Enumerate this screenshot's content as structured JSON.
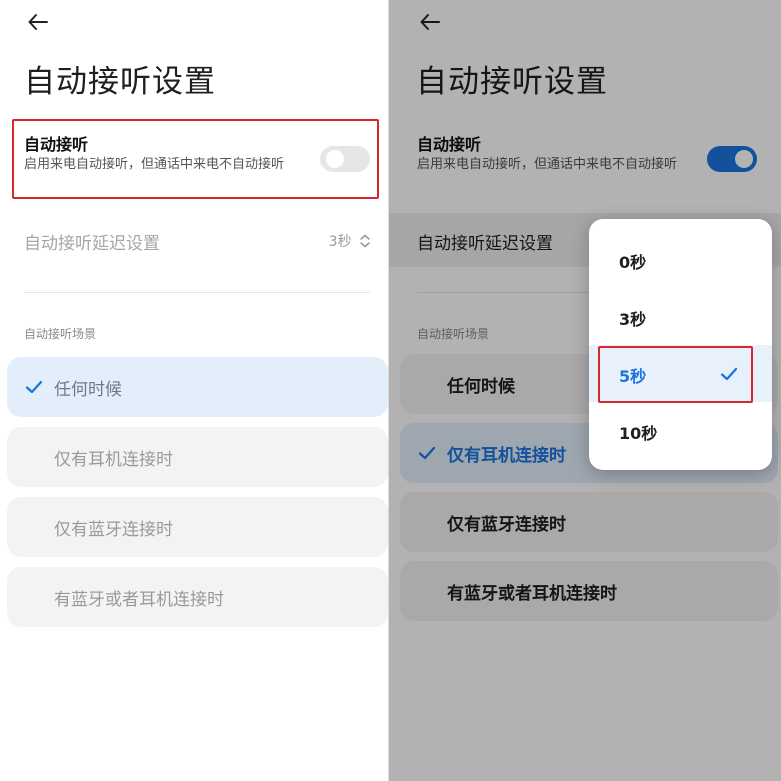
{
  "colors": {
    "accent": "#1a74e0",
    "highlight_box": "#d8262e",
    "selected_bg": "#e3eefb",
    "option_bg": "#f3f3f3"
  },
  "left": {
    "back_icon": "arrow-left-icon",
    "title": "自动接听设置",
    "auto_answer": {
      "title": "自动接听",
      "description": "启用来电自动接听，但通话中来电不自动接听",
      "enabled": false
    },
    "delay": {
      "label": "自动接听延迟设置",
      "value": "3秒",
      "icon": "chevron-up-down-icon"
    },
    "scene_section": "自动接听场景",
    "scenes": [
      {
        "label": "任何时候",
        "selected": true
      },
      {
        "label": "仅有耳机连接时",
        "selected": false
      },
      {
        "label": "仅有蓝牙连接时",
        "selected": false
      },
      {
        "label": "有蓝牙或者耳机连接时",
        "selected": false
      }
    ]
  },
  "right": {
    "back_icon": "arrow-left-icon",
    "title": "自动接听设置",
    "auto_answer": {
      "title": "自动接听",
      "description": "启用来电自动接听，但通话中来电不自动接听",
      "enabled": true
    },
    "delay": {
      "label": "自动接听延迟设置"
    },
    "scene_section": "自动接听场景",
    "scenes": [
      {
        "label": "任何时候",
        "selected": false
      },
      {
        "label": "仅有耳机连接时",
        "selected": true
      },
      {
        "label": "仅有蓝牙连接时",
        "selected": false
      },
      {
        "label": "有蓝牙或者耳机连接时",
        "selected": false
      }
    ],
    "dropdown": {
      "options": [
        {
          "label": "0秒",
          "selected": false
        },
        {
          "label": "3秒",
          "selected": false
        },
        {
          "label": "5秒",
          "selected": true
        },
        {
          "label": "10秒",
          "selected": false
        }
      ]
    }
  }
}
